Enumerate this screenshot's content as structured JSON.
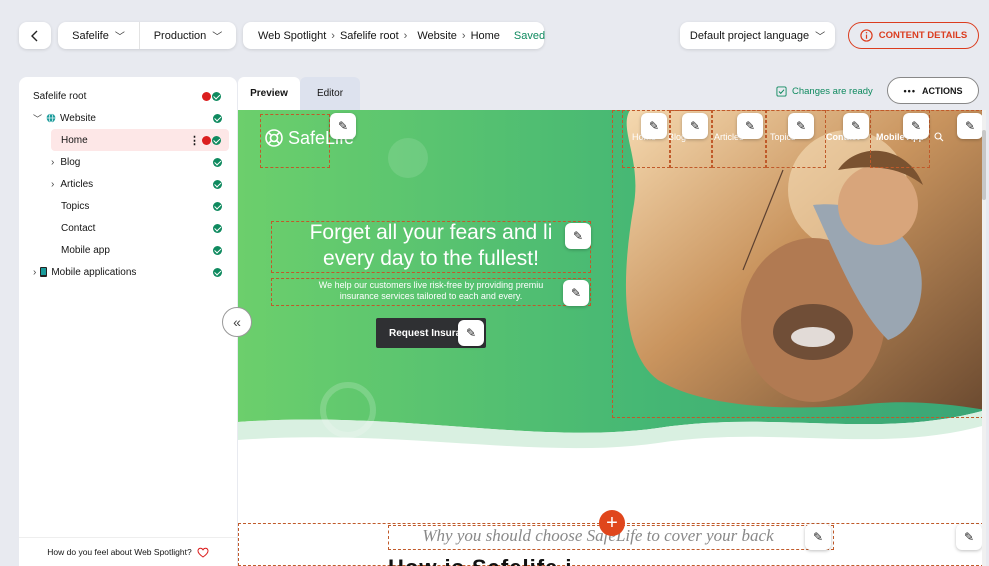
{
  "topbar": {
    "back_icon": "chevron-left-icon",
    "project": "Safelife",
    "environment": "Production",
    "breadcrumb": {
      "app": "Web Spotlight",
      "root": "Safelife root",
      "website": "Website",
      "page": "Home",
      "status": "Saved"
    },
    "language": "Default project language",
    "content_details": "CONTENT DETAILS"
  },
  "tabs": {
    "preview": "Preview",
    "editor": "Editor"
  },
  "status": {
    "changes_ready": "Changes are ready",
    "actions": "ACTIONS"
  },
  "tree": {
    "root": "Safelife root",
    "items": [
      {
        "label": "Website"
      },
      {
        "label": "Home"
      },
      {
        "label": "Blog"
      },
      {
        "label": "Articles"
      },
      {
        "label": "Topics"
      },
      {
        "label": "Contact"
      },
      {
        "label": "Mobile app"
      },
      {
        "label": "Mobile applications"
      }
    ]
  },
  "feedback": "How do you feel about Web Spotlight?",
  "site": {
    "logo": "SafeLife",
    "nav": [
      "Home",
      "Blog",
      "Articles",
      "Topics",
      "Contact",
      "Mobile App"
    ],
    "hero_title_1": "Forget all your fears and li",
    "hero_title_2": "every day to the fullest!",
    "hero_sub_1": "We help our customers live risk-free by providing premiu",
    "hero_sub_2": "insurance services tailored to each and every.",
    "cta": "Request Insura",
    "why": "Why you should choose SafeLife to cover your back",
    "next_heading": "How is Safelife i"
  },
  "colors": {
    "accent": "#db3c1e",
    "green": "#0f8a5f",
    "hero_green": "#4fc27f"
  }
}
